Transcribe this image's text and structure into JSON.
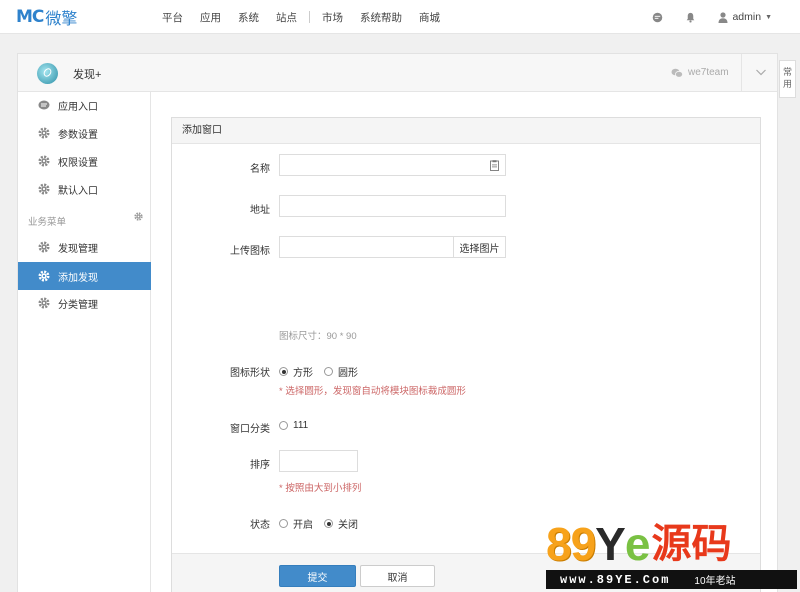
{
  "brand": {
    "mark": "MC",
    "name": "微擎"
  },
  "nav": {
    "items": [
      "平台",
      "应用",
      "系统",
      "站点",
      "市场",
      "系统帮助",
      "商城"
    ]
  },
  "user": {
    "name": "admin"
  },
  "panel": {
    "title": "发现+",
    "team": "we7team"
  },
  "sidetab": {
    "label": "常用"
  },
  "sidebar": {
    "items": [
      {
        "label": "应用入口",
        "icon": "comment-icon"
      },
      {
        "label": "参数设置",
        "icon": "gear-icon"
      },
      {
        "label": "权限设置",
        "icon": "gear-icon"
      },
      {
        "label": "默认入口",
        "icon": "gear-icon"
      }
    ],
    "group_label": "业务菜单",
    "group_items": [
      {
        "label": "发现管理",
        "icon": "gear-icon"
      },
      {
        "label": "添加发现",
        "icon": "gear-icon",
        "active": true
      },
      {
        "label": "分类管理",
        "icon": "gear-icon"
      }
    ]
  },
  "form": {
    "title": "添加窗口",
    "name_label": "名称",
    "name_value": "",
    "address_label": "地址",
    "address_value": "",
    "upload_label": "上传图标",
    "upload_value": "",
    "upload_button": "选择图片",
    "icon_size_help": "图标尺寸：90 * 90",
    "shape_label": "图标形状",
    "shape_options": [
      "方形",
      "圆形"
    ],
    "shape_selected": "方形",
    "shape_help": "* 选择圆形，发现窗自动将模块图标裁成圆形",
    "category_label": "窗口分类",
    "category_options": [
      "111"
    ],
    "sort_label": "排序",
    "sort_value": "",
    "sort_help": "* 按照由大到小排列",
    "status_label": "状态",
    "status_options": [
      "开启",
      "关闭"
    ],
    "status_selected": "关闭",
    "submit_label": "提交",
    "cancel_label": "取消"
  },
  "watermark": {
    "digits": "89",
    "y": "Y",
    "e": "e",
    "cn": "源码",
    "url": "www.89YE.Com",
    "slogan": "10年老站"
  },
  "colors": {
    "primary": "#428bca",
    "brand": "#2e82cc",
    "watermark_orange": "#f7a21b",
    "watermark_red": "#e8391b"
  }
}
